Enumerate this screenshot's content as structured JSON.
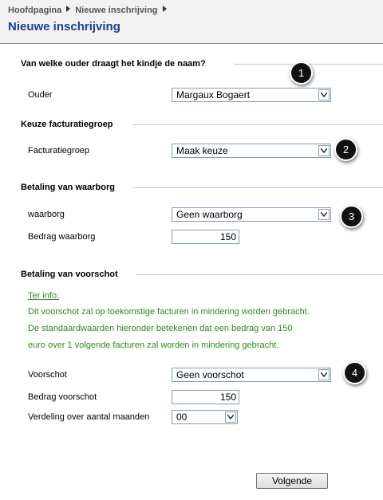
{
  "breadcrumb": {
    "items": [
      "Hoofdpagina",
      "Nieuwe inschrijving"
    ]
  },
  "page_title": "Nieuwe inschrijving",
  "sections": {
    "ouder": {
      "heading": "Van welke ouder draagt het kindje de naam?",
      "label": "Ouder",
      "value": "Margaux Bogaert",
      "badge": "1"
    },
    "facturatie": {
      "heading": "Keuze facturatiegroep",
      "label": "Facturatiegroep",
      "value": "Maak keuze",
      "badge": "2"
    },
    "waarborg": {
      "heading": "Betaling van waarborg",
      "label": "waarborg",
      "value": "Geen waarborg",
      "badge": "3",
      "amount_label": "Bedrag waarborg",
      "amount_value": "150"
    },
    "voorschot": {
      "heading": "Betaling van voorschot",
      "info_title": "Ter info:",
      "info_lines": [
        "Dit voorschot zal op toekomstige facturen in mindering worden gebracht.",
        "De standaardwaarden hieronder betekenen dat een bedrag van 150",
        "euro over 1 volgende facturen zal worden in mindering gebracht."
      ],
      "label": "Voorschot",
      "value": "Geen voorschot",
      "badge": "4",
      "amount_label": "Bedrag voorschot",
      "amount_value": "150",
      "months_label": "Verdeling over aantal maanden",
      "months_value": "00"
    }
  },
  "next_button": "Volgende",
  "colors": {
    "title": "#1b3f94",
    "info_text": "#2a8c1a",
    "select_border": "#7f9db9"
  }
}
